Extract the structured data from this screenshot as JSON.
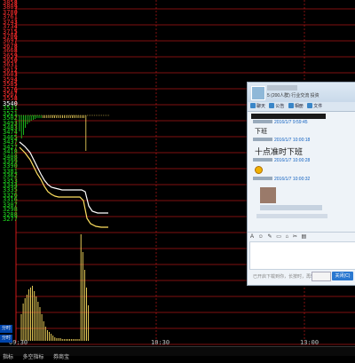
{
  "price_axis": {
    "labels_red": [
      "3858",
      "3809",
      "3780",
      "3761",
      "3743",
      "3734",
      "3715",
      "3706",
      "3697",
      "3678",
      "3668",
      "3659",
      "3650",
      "3631",
      "3612",
      "3603",
      "3594",
      "3585",
      "3576",
      "3567",
      "3558"
    ],
    "label_white": "3540",
    "labels_green": [
      "3531",
      "3521",
      "3502",
      "3493",
      "3483",
      "3474",
      "3465",
      "3437",
      "3427",
      "3418",
      "3408",
      "3399",
      "3390",
      "3381",
      "3362",
      "3353",
      "3344",
      "3335",
      "3326",
      "3316",
      "3307",
      "3298",
      "3288",
      "3277"
    ]
  },
  "time_axis": {
    "start": "09:30",
    "mid": "10:30",
    "end": "13:00"
  },
  "bottom_tabs": [
    "指标",
    "多空指标",
    "券商宝"
  ],
  "side_buttons": [
    "分时",
    "分时"
  ],
  "chat": {
    "group_title": "5 (200人群) 行业交流 投资",
    "tabs": [
      "聊天",
      "公告",
      "相册",
      "文件"
    ],
    "messages": [
      {
        "time": "2016/1/7 9:59:45",
        "text": "下班"
      },
      {
        "time": "2016/1/7 10:00:18",
        "text": "十点准时下班"
      },
      {
        "time": "2016/1/7 10:00:28",
        "text": ""
      },
      {
        "time": "2016/1/7 10:00:32",
        "text": ""
      }
    ],
    "toolbar_icons": [
      "A",
      "☺",
      "✎",
      "▭",
      "⌂",
      "✂",
      "▤"
    ],
    "input_hint": "已开启下载到你，长按时，再轻",
    "send_label": "关闭(C)"
  },
  "colors": {
    "grid": "#ff2020",
    "price_line": "#ffffff",
    "avg_line": "#ffe060",
    "volume": "#ffe060",
    "neg_volume": "#20e020"
  }
}
